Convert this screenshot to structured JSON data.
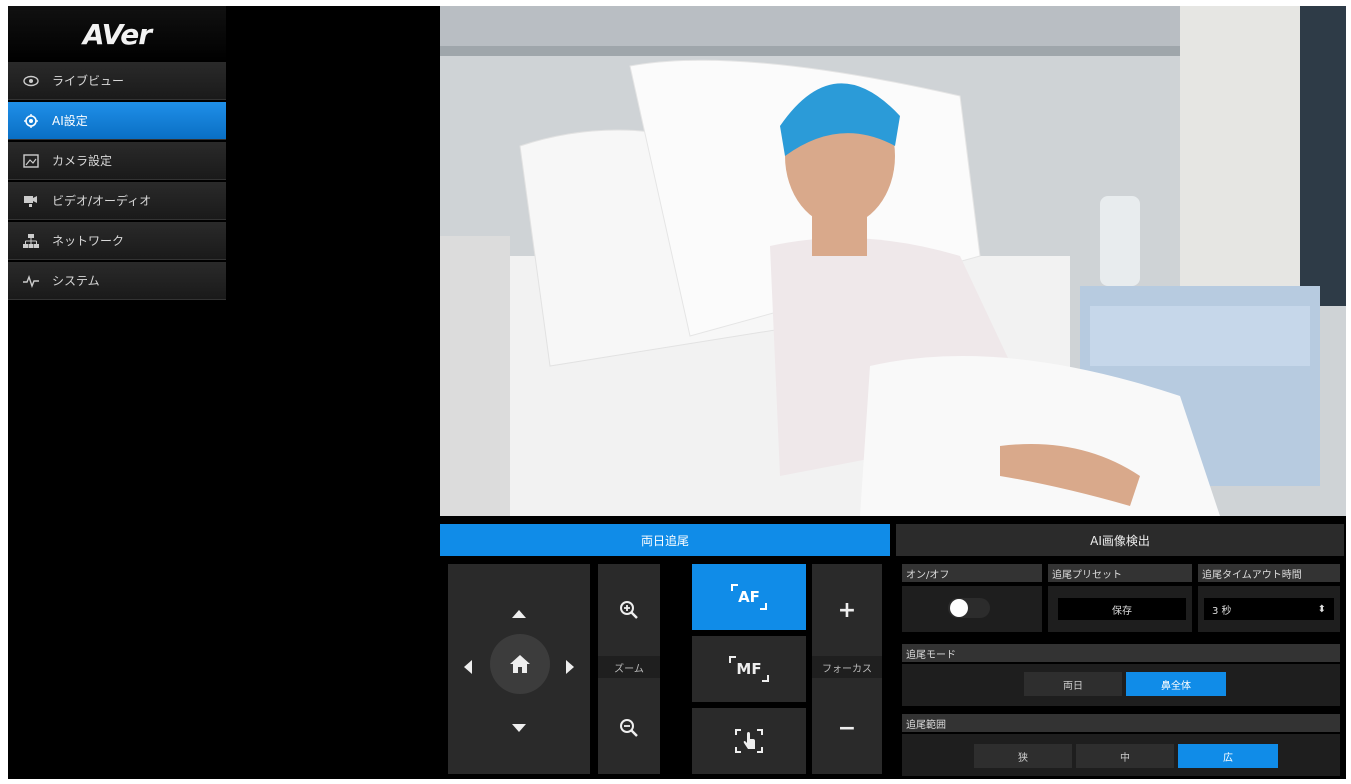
{
  "brand": {
    "logo": "AVer"
  },
  "sidebar": {
    "items": [
      {
        "label": "ライブビュー",
        "icon": "eye-icon"
      },
      {
        "label": "AI設定",
        "icon": "target-icon"
      },
      {
        "label": "カメラ設定",
        "icon": "image-icon"
      },
      {
        "label": "ビデオ/オーディオ",
        "icon": "video-audio-icon"
      },
      {
        "label": "ネットワーク",
        "icon": "network-icon"
      },
      {
        "label": "システム",
        "icon": "pulse-icon"
      }
    ],
    "active_index": 1
  },
  "tabs": {
    "tracking": "両日追尾",
    "detection": "AI画像検出"
  },
  "ptz": {
    "zoom_label": "ズーム",
    "focus_label": "フォーカス",
    "af_label": "AF",
    "mf_label": "MF",
    "focus_plus": "+",
    "focus_minus": "−"
  },
  "settings": {
    "onoff_header": "オン/オフ",
    "onoff_value": "off",
    "preset_header": "追尾プリセット",
    "preset_button": "保存",
    "timeout_header": "追尾タイムアウト時間",
    "timeout_value": "3 秒",
    "mode_header": "追尾モード",
    "mode_options": [
      "両日",
      "鼻全体"
    ],
    "mode_selected": 1,
    "range_header": "追尾範囲",
    "range_options": [
      "狭",
      "中",
      "広"
    ],
    "range_selected": 2
  },
  "colors": {
    "accent": "#108ce8",
    "background": "#000000",
    "panel": "#2a2a2a"
  }
}
